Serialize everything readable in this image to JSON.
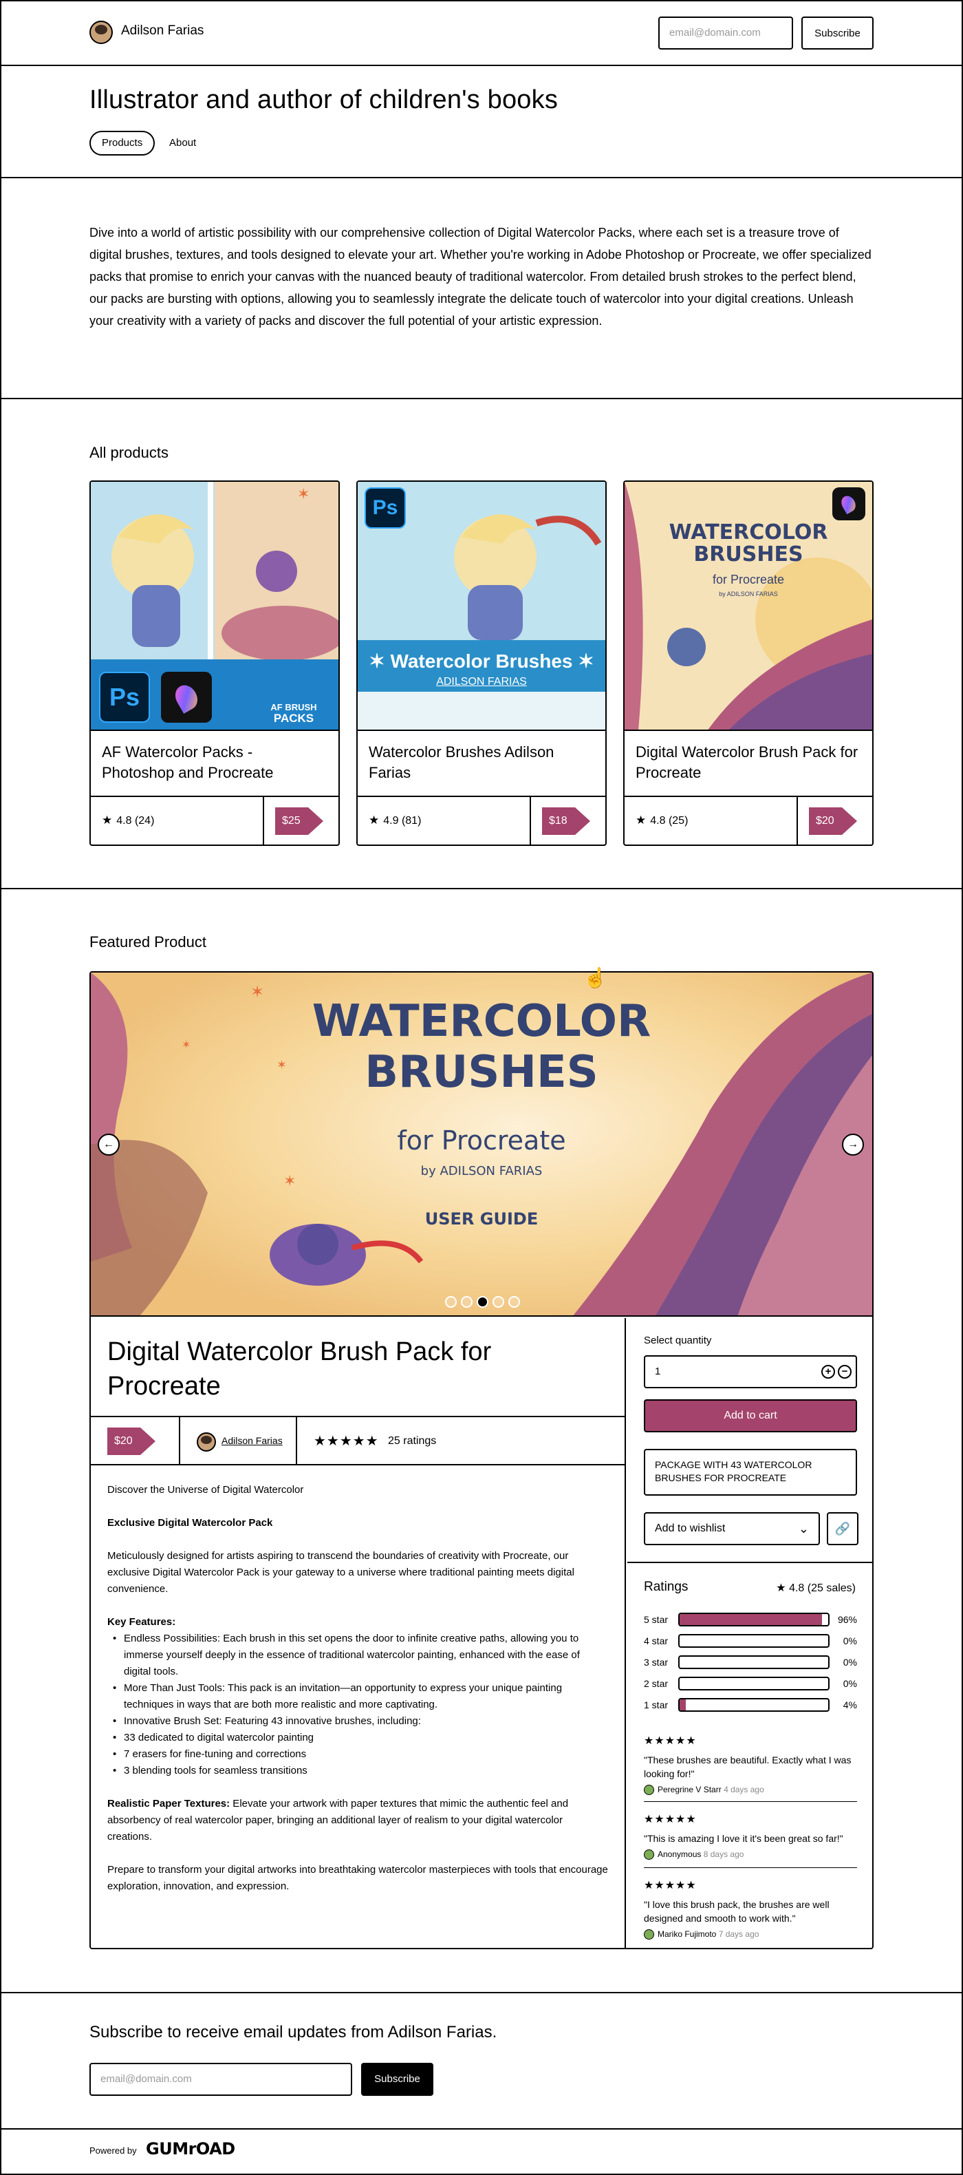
{
  "header": {
    "creator_name": "Adilson Farias",
    "email_placeholder": "email@domain.com",
    "subscribe_label": "Subscribe"
  },
  "profile": {
    "headline": "Illustrator and author of children's books",
    "nav": [
      "Products",
      "About"
    ]
  },
  "intro": "Dive into a world of artistic possibility with our comprehensive collection of Digital Watercolor Packs, where each set is a treasure trove of digital brushes, textures, and tools designed to elevate your art. Whether you're working in Adobe Photoshop or Procreate, we offer specialized packs that promise to enrich your canvas with the nuanced beauty of traditional watercolor. From detailed brush strokes to the perfect blend, our packs are bursting with options, allowing you to seamlessly integrate the delicate touch of watercolor into your digital creations. Unleash your creativity with a variety of packs and discover the full potential of your artistic expression.",
  "all_products": {
    "title": "All products",
    "items": [
      {
        "title": "AF Watercolor Packs - Photoshop and Procreate",
        "rating": "4.8 (24)",
        "price": "$25",
        "img_text": "AF BRUSH\nPACKS",
        "img_text_1": "AF BRUSH",
        "img_text_2": "PACKS"
      },
      {
        "title": "Watercolor Brushes Adilson Farias",
        "rating": "4.9 (81)",
        "price": "$18",
        "img_text_1": "✶ Watercolor Brushes ✶",
        "img_text_2": "ADILSON FARIAS"
      },
      {
        "title": "Digital Watercolor Brush Pack for Procreate",
        "rating": "4.8 (25)",
        "price": "$20",
        "img_text_1": "WATERCOLOR",
        "img_text_2": "BRUSHES",
        "img_text_3": "for Procreate",
        "img_text_4": "by ADILSON FARIAS"
      }
    ]
  },
  "featured": {
    "section_title": "Featured Product",
    "hero": {
      "line1": "WATERCOLOR",
      "line2": "BRUSHES",
      "line3": "for Procreate",
      "line4": "by ADILSON FARIAS",
      "line5": "USER GUIDE",
      "slide_count": 5,
      "active_slide": 3
    },
    "name": "Digital Watercolor Brush Pack for Procreate",
    "price": "$20",
    "seller": "Adilson Farias",
    "ratings_label": "25 ratings",
    "stars": "★★★★★",
    "description": {
      "p1": "Discover the Universe of Digital Watercolor",
      "p2": "Exclusive Digital Watercolor Pack",
      "p3": "Meticulously designed for artists aspiring to transcend the boundaries of creativity with Procreate, our exclusive Digital Watercolor Pack is your gateway to a universe where traditional painting meets digital convenience.",
      "key_features_label": "Key Features:",
      "f1": "Endless Possibilities: Each brush in this set opens the door to infinite creative paths, allowing you to immerse yourself deeply in the essence of traditional watercolor painting, enhanced with the ease of digital tools.",
      "f2": "More Than Just Tools: This pack is an invitation—an opportunity to express your unique painting techniques in ways that are both more realistic and more captivating.",
      "f3": "Innovative Brush Set: Featuring 43 innovative brushes, including:",
      "s1": "33 dedicated to digital watercolor painting",
      "s2": "7 erasers for fine-tuning and corrections",
      "s3": "3 blending tools for seamless transitions",
      "paper_label": "Realistic Paper Textures:",
      "paper_text": " Elevate your artwork with paper textures that mimic the authentic feel and absorbency of real watercolor paper, bringing an additional layer of realism to your digital watercolor creations.",
      "closing": "Prepare to transform your digital artworks into breathtaking watercolor masterpieces with tools that encourage exploration, innovation, and expression."
    },
    "purchase": {
      "qty_label": "Select quantity",
      "qty_value": "1",
      "add_to_cart": "Add to cart",
      "package_note": "PACKAGE WITH 43 WATERCOLOR BRUSHES FOR PROCREATE",
      "wishlist": "Add to wishlist"
    },
    "ratings": {
      "title": "Ratings",
      "average": "4.8 (25 sales)",
      "bars": [
        {
          "label": "5 star",
          "pct": "96%",
          "value": 96
        },
        {
          "label": "4 star",
          "pct": "0%",
          "value": 0
        },
        {
          "label": "3 star",
          "pct": "0%",
          "value": 0
        },
        {
          "label": "2 star",
          "pct": "0%",
          "value": 0
        },
        {
          "label": "1 star",
          "pct": "4%",
          "value": 4
        }
      ],
      "reviews": [
        {
          "stars": "★★★★★",
          "text": "\"These brushes are beautiful. Exactly what I was looking for!\"",
          "author": "Peregrine V Starr",
          "when": "4 days ago"
        },
        {
          "stars": "★★★★★",
          "text": "\"This is amazing I love it it's been great so far!\"",
          "author": "Anonymous",
          "when": "8 days ago"
        },
        {
          "stars": "★★★★★",
          "text": "\"I love this brush pack, the brushes are well designed and smooth to work with.\"",
          "author": "Mariko Fujimoto",
          "when": "7 days ago"
        }
      ]
    }
  },
  "subscribe": {
    "title": "Subscribe to receive email updates from Adilson Farias.",
    "placeholder": "email@domain.com",
    "button": "Subscribe"
  },
  "footer": {
    "powered_by": "Powered by",
    "brand": "GUMrOAD"
  },
  "colors": {
    "accent": "#a4436b",
    "hero_title": "#344371"
  }
}
